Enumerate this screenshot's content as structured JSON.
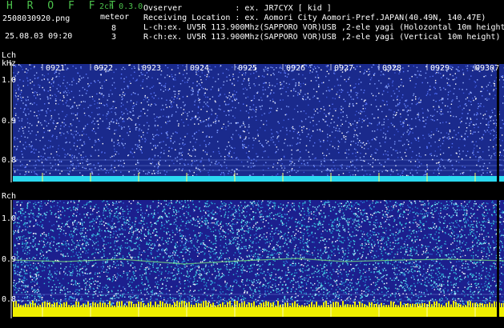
{
  "header": {
    "title": "H R O F F T",
    "version": "2ch 0.3.0",
    "filename": "2508030920.png",
    "meteor_label": "meteor",
    "l_count": "8",
    "r_count": "3",
    "datetime": "25.08.03 09:20",
    "observer": "Ovserver           : ex. JR7CYX [ kid ]",
    "location": "Receiving Location : ex. Aomori City Aomori-Pref.JAPAN(40.49N, 140.47E)",
    "lch_info": "L-ch:ex. UV5R 113.900Mhz(SAPPORO VOR)USB ,2-ele yagi (Holozontal 10m height",
    "rch_info": "R-ch:ex. UV5R 113.900Mhz(SAPPORO VOR)USB ,2-ele yagi (Vertical 10m height)"
  },
  "lch": {
    "label": "Lch",
    "unit": "kHz",
    "yticks": [
      "1.0",
      "0.9",
      "0.8"
    ]
  },
  "rch": {
    "label": "Rch",
    "yticks": [
      "1.0",
      "0.9",
      "0.8"
    ]
  },
  "time_labels": [
    "0921",
    "0922",
    "0923",
    "0924",
    "0925",
    "0926",
    "0927",
    "0928",
    "0929",
    "09307"
  ],
  "colors": {
    "lch_bg": "#1a2a8c",
    "rch_bg": "#1c1f8e",
    "lch_floor": "#2bd8f0",
    "rch_floor": "#f0f000",
    "accent_green": "#4cc34c"
  }
}
